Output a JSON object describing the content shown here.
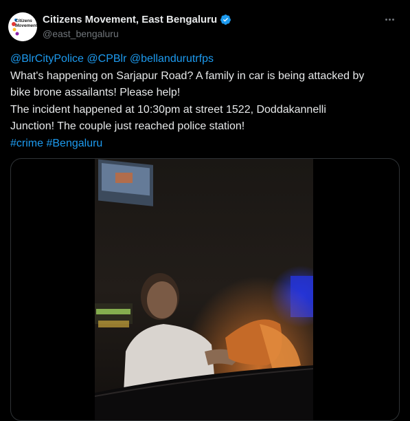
{
  "account": {
    "display_name": "Citizens Movement, East Bengaluru",
    "handle": "@east_bengaluru",
    "avatar_text": "Citizens Movement",
    "verified": true
  },
  "tweet": {
    "mentions": [
      "@BlrCityPolice",
      "@CPBlr",
      "@bellandurutrfps"
    ],
    "line1": "What's happening on Sarjapur Road? A family in car is being attacked by",
    "line2": "bike brone assailants! Please help!",
    "line3": "The incident happened at 10:30pm at street 1522, Doddakannelli",
    "line4": "Junction! The couple just reached police station!",
    "hashtags": [
      "#crime",
      "#Bengaluru"
    ]
  },
  "media": {
    "type": "video",
    "description_icon": "video-thumbnail"
  },
  "colors": {
    "background": "#000000",
    "text": "#e7e9ea",
    "muted": "#71767b",
    "link": "#1d9bf0",
    "verified": "#1d9bf0",
    "border": "#2f3336"
  }
}
